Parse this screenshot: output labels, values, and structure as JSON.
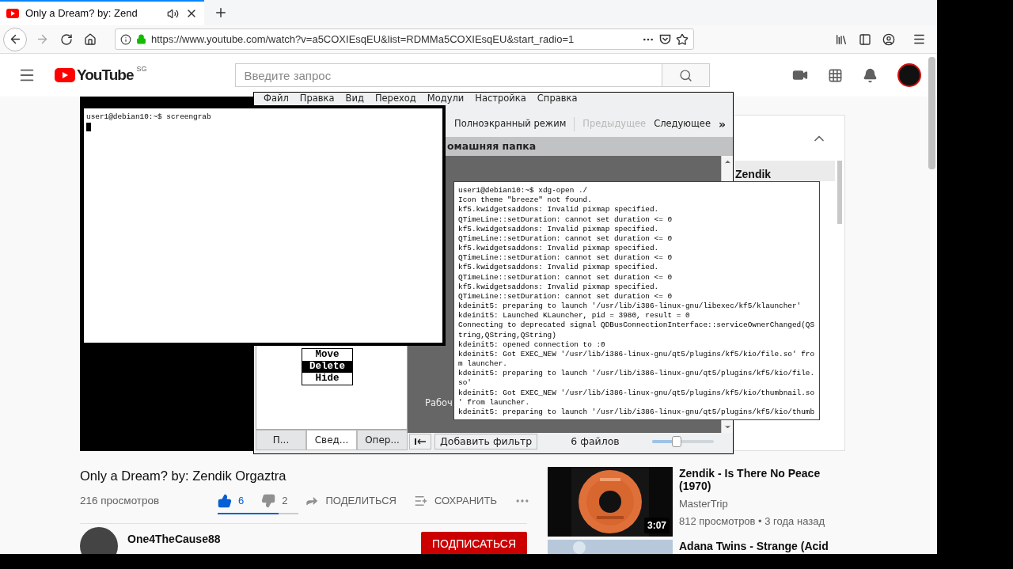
{
  "browser": {
    "tab": {
      "title": "Only a Dream? by: Zend",
      "selected": true
    },
    "url": "https://www.youtube.com/watch?v=a5COXIEsqEU&list=RDMMa5COXIEsqEU&start_radio=1"
  },
  "youtube": {
    "logo": "YouTube",
    "region": "SG",
    "search_placeholder": "Введите запрос",
    "video": {
      "title": "Only a Dream? by: Zendik Orgaztra",
      "views": "216 просмотров",
      "likes": "6",
      "liked": true,
      "dislikes": "2",
      "sentiment": {
        "level": 0.75
      },
      "share": "ПОДЕЛИТЬСЯ",
      "save": "СОХРАНИТЬ"
    },
    "channel": {
      "name": "One4TheCause88",
      "subscribe": "ПОДПИСАТЬСЯ"
    },
    "playlist": {
      "items": [
        {
          "title": "Zendik",
          "selected": true
        }
      ]
    },
    "recommendations": [
      {
        "title": "Zendik - Is There No Peace (1970)",
        "channel": "MasterTrip",
        "meta": "812 просмотров • 3 года назад",
        "duration": "3:07"
      },
      {
        "title": "Adana Twins - Strange (Acid"
      }
    ]
  },
  "file_manager": {
    "menu": [
      "Файл",
      "Правка",
      "Вид",
      "Переход",
      "Модули",
      "Настройка",
      "Справка"
    ],
    "toolbar": [
      {
        "label": "Полноэкранный режим",
        "disabled": false
      },
      {
        "label": "Предыдущее",
        "disabled": true
      },
      {
        "label": "Следующее",
        "disabled": false
      }
    ],
    "overflow": "»",
    "location": "омашняя папка",
    "view_items": [
      "Рабоч"
    ],
    "panel_tabs": [
      {
        "label": "П...",
        "selected": false
      },
      {
        "label": "Свед...",
        "selected": true
      },
      {
        "label": "Опер...",
        "selected": false
      }
    ],
    "filter_button": "Добавить фильтр",
    "file_count": "6 файлов",
    "zoom": {
      "level": 0.4
    }
  },
  "context_menu": [
    {
      "label": "Move",
      "selected": false
    },
    {
      "label": "Delete",
      "selected": true
    },
    {
      "label": "Hide",
      "selected": false
    }
  ],
  "terminals": [
    {
      "cursor": true,
      "lines": [
        "user1@debian10:~$ screengrab"
      ]
    },
    {
      "cursor": false,
      "lines": [
        "user1@debian10:~$ xdg-open ./",
        "Icon theme \"breeze\" not found.",
        "kf5.kwidgetsaddons: Invalid pixmap specified.",
        "QTimeLine::setDuration: cannot set duration <= 0",
        "kf5.kwidgetsaddons: Invalid pixmap specified.",
        "QTimeLine::setDuration: cannot set duration <= 0",
        "kf5.kwidgetsaddons: Invalid pixmap specified.",
        "QTimeLine::setDuration: cannot set duration <= 0",
        "kf5.kwidgetsaddons: Invalid pixmap specified.",
        "QTimeLine::setDuration: cannot set duration <= 0",
        "kf5.kwidgetsaddons: Invalid pixmap specified.",
        "QTimeLine::setDuration: cannot set duration <= 0",
        "kdeinit5: preparing to launch '/usr/lib/i386-linux-gnu/libexec/kf5/klauncher'",
        "kdeinit5: Launched KLauncher, pid = 3980, result = 0",
        "Connecting to deprecated signal QDBusConnectionInterface::serviceOwnerChanged(QS",
        "tring,QString,QString)",
        "kdeinit5: opened connection to :0",
        "kdeinit5: Got EXEC_NEW '/usr/lib/i386-linux-gnu/qt5/plugins/kf5/kio/file.so' fro",
        "m launcher.",
        "kdeinit5: preparing to launch '/usr/lib/i386-linux-gnu/qt5/plugins/kf5/kio/file.",
        "so'",
        "kdeinit5: Got EXEC_NEW '/usr/lib/i386-linux-gnu/qt5/plugins/kf5/kio/thumbnail.so",
        "' from launcher.",
        "kdeinit5: preparing to launch '/usr/lib/i386-linux-gnu/qt5/plugins/kf5/kio/thumb"
      ]
    }
  ]
}
